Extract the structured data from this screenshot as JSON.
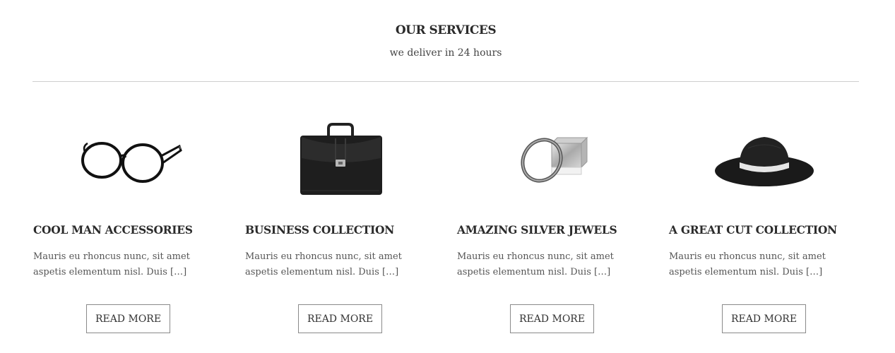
{
  "section": {
    "title": "OUR SERVICES",
    "subtitle": "we deliver in 24 hours"
  },
  "cards": [
    {
      "icon": "glasses-icon",
      "title": "COOL MAN ACCESSORIES",
      "text": "Mauris eu rhoncus nunc, sit amet aspetis elementum nisl. Duis […]",
      "button": "READ MORE"
    },
    {
      "icon": "briefcase-icon",
      "title": "BUSINESS COLLECTION",
      "text": "Mauris eu rhoncus nunc, sit amet aspetis elementum nisl. Duis […]",
      "button": "READ MORE"
    },
    {
      "icon": "bracelet-icon",
      "title": "AMAZING SILVER JEWELS",
      "text": "Mauris eu rhoncus nunc, sit amet aspetis elementum nisl. Duis […]",
      "button": "READ MORE"
    },
    {
      "icon": "hat-icon",
      "title": "A GREAT CUT COLLECTION",
      "text": "Mauris eu rhoncus nunc, sit amet aspetis elementum nisl. Duis […]",
      "button": "READ MORE"
    }
  ],
  "colors": {
    "text": "#2b2b2b",
    "body_text": "#555555",
    "divider": "#cfcfcf",
    "button_border": "#8a8a8a"
  }
}
